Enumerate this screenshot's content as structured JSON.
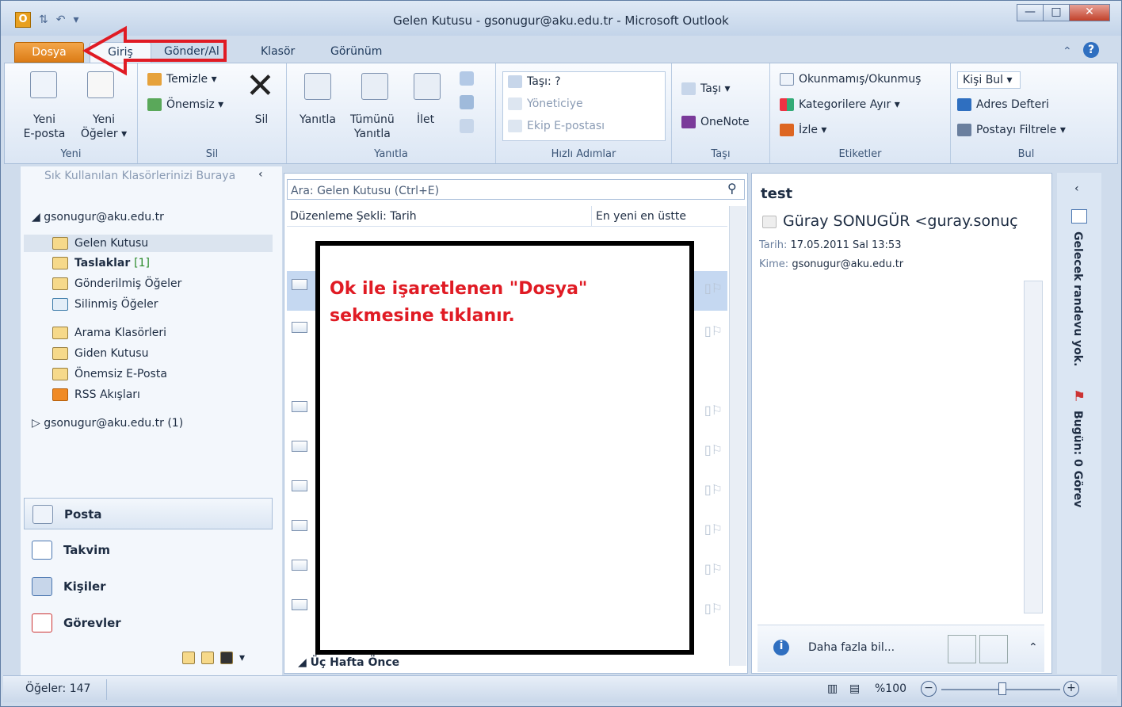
{
  "window": {
    "title": "Gelen Kutusu - gsonugur@aku.edu.tr - Microsoft Outlook",
    "min": "—",
    "max": "□",
    "close": "✕"
  },
  "tabs": [
    {
      "label": "Dosya"
    },
    {
      "label": "Giriş"
    },
    {
      "label": "Gönder/Al"
    },
    {
      "label": "Klasör"
    },
    {
      "label": "Görünüm"
    }
  ],
  "ribbon": {
    "yeni": {
      "new_mail": "Yeni\nE-posta",
      "new_items": "Yeni\nÖğeler ▾",
      "group": "Yeni"
    },
    "sil": {
      "cleanup": "Temizle ▾",
      "junk": "Önemsiz ▾",
      "delete": "Sil",
      "group": "Sil"
    },
    "yanitla": {
      "reply": "Yanıtla",
      "reply_all": "Tümünü\nYanıtla",
      "forward": "İlet",
      "group": "Yanıtla"
    },
    "hizli": {
      "move": "Taşı: ?",
      "manager": "Yöneticiye",
      "team": "Ekip E-postası",
      "group": "Hızlı Adımlar"
    },
    "tasi": {
      "move": "Taşı ▾",
      "onenote": "OneNote",
      "group": "Taşı"
    },
    "etiket": {
      "unread": "Okunmamış/Okunmuş",
      "categorize": "Kategorilere Ayır ▾",
      "follow": "İzle ▾",
      "group": "Etiketler"
    },
    "bul": {
      "find": "Kişi Bul ▾",
      "address": "Adres Defteri",
      "filter": "Postayı Filtrele ▾",
      "group": "Bul"
    }
  },
  "nav": {
    "fav_hint": "Sık Kullanılan Klasörlerinizi Buraya",
    "account": "◢ gsonugur@aku.edu.tr",
    "folders": [
      "Gelen Kutusu",
      "Taslaklar",
      "Gönderilmiş Öğeler",
      "Silinmiş Öğeler",
      "Arama Klasörleri",
      "Giden Kutusu",
      "Önemsiz E-Posta",
      "RSS Akışları"
    ],
    "drafts_count": "[1]",
    "account2": "▷ gsonugur@aku.edu.tr (1)",
    "modules": [
      "Posta",
      "Takvim",
      "Kişiler",
      "Görevler"
    ]
  },
  "list": {
    "search_placeholder": "Ara: Gelen Kutusu (Ctrl+E)",
    "sort_by": "Düzenleme Şekli: Tarih",
    "order": "En yeni en üstte",
    "group_footer": "Üç Hafta Önce"
  },
  "reading": {
    "subject": "test",
    "from": "Güray SONUGÜR <guray.sonuç",
    "date_label": "Tarih:",
    "date": "17.05.2011 Sal 13:53",
    "to_label": "Kime:",
    "to": "gsonugur@aku.edu.tr",
    "more": "Daha fazla bil..."
  },
  "todo": {
    "calendar": "Gelecek randevu yok.",
    "tasks": "Bugün: 0 Görev"
  },
  "status": {
    "items": "Öğeler: 147",
    "zoom": "%100"
  },
  "annotation": {
    "line1": "Ok ile işaretlenen \"Dosya\"",
    "line2": "sekmesine tıklanır."
  },
  "colors": {
    "accent": "#dc7c16",
    "annotation_text": "#e01b24",
    "arrow": "#e01b24"
  }
}
